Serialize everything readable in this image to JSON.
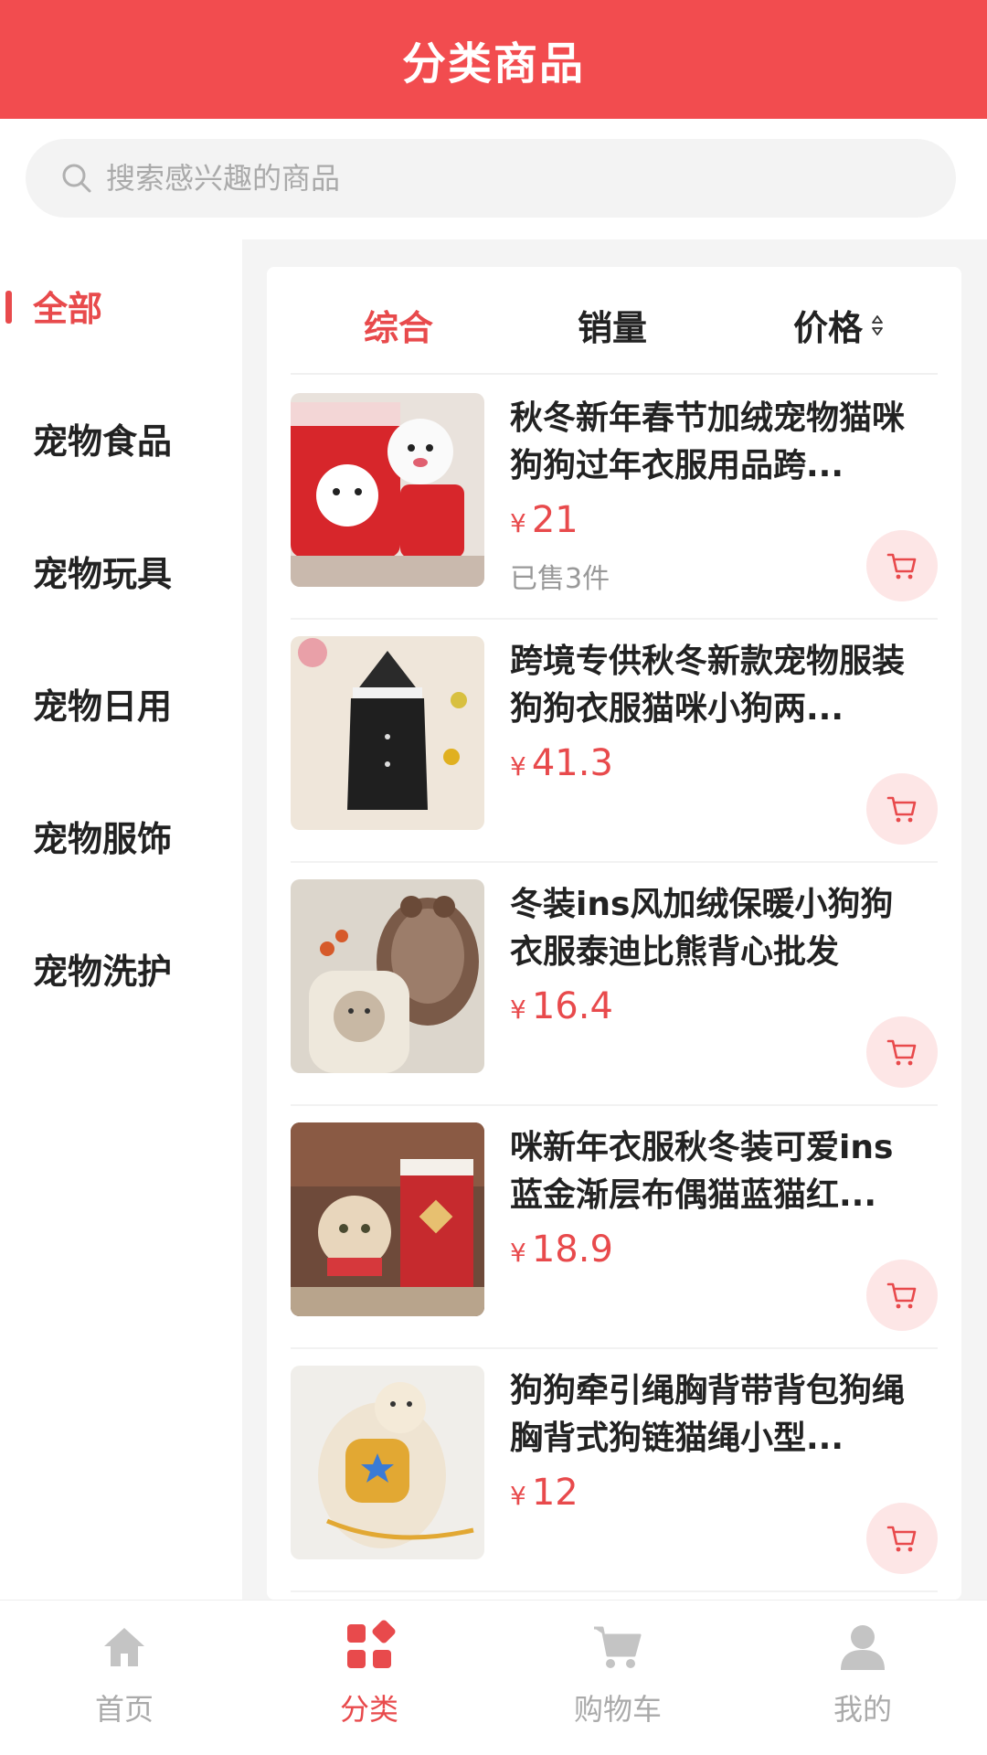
{
  "header": {
    "title": "分类商品"
  },
  "search": {
    "placeholder": "搜索感兴趣的商品"
  },
  "sidebar": {
    "items": [
      {
        "label": "全部",
        "active": true
      },
      {
        "label": "宠物食品",
        "active": false
      },
      {
        "label": "宠物玩具",
        "active": false
      },
      {
        "label": "宠物日用",
        "active": false
      },
      {
        "label": "宠物服饰",
        "active": false
      },
      {
        "label": "宠物洗护",
        "active": false
      }
    ]
  },
  "sort": {
    "tabs": [
      {
        "label": "综合",
        "active": true
      },
      {
        "label": "销量",
        "active": false
      },
      {
        "label": "价格",
        "active": false
      }
    ]
  },
  "products": [
    {
      "name": "秋冬新年春节加绒宠物猫咪狗狗过年衣服用品跨...",
      "currency": "¥",
      "price": "21",
      "sold": "已售3件",
      "image": "red-pet-sweater-photo"
    },
    {
      "name": "跨境专供秋冬新款宠物服装狗狗衣服猫咪小狗两...",
      "currency": "¥",
      "price": "41.3",
      "sold": "",
      "image": "black-hooded-pet-jacket-photo"
    },
    {
      "name": "冬装ins风加绒保暖小狗狗衣服泰迪比熊背心批发",
      "currency": "¥",
      "price": "16.4",
      "sold": "",
      "image": "fleece-bear-vest-photo"
    },
    {
      "name": "咪新年衣服秋冬装可爱ins蓝金渐层布偶猫蓝猫红...",
      "currency": "¥",
      "price": "18.9",
      "sold": "",
      "image": "cat-red-cape-photo"
    },
    {
      "name": "狗狗牵引绳胸背带背包狗绳胸背式狗链猫绳小型...",
      "currency": "¥",
      "price": "12",
      "sold": "",
      "image": "dog-harness-backpack-photo"
    }
  ],
  "tabbar": {
    "items": [
      {
        "label": "首页",
        "icon": "home-icon",
        "active": false
      },
      {
        "label": "分类",
        "icon": "category-icon",
        "active": true
      },
      {
        "label": "购物车",
        "icon": "cart-icon",
        "active": false
      },
      {
        "label": "我的",
        "icon": "user-icon",
        "active": false
      }
    ]
  },
  "colors": {
    "brand": "#f24c4f",
    "accent": "#e84a4c",
    "muted": "#aaaaaa"
  }
}
